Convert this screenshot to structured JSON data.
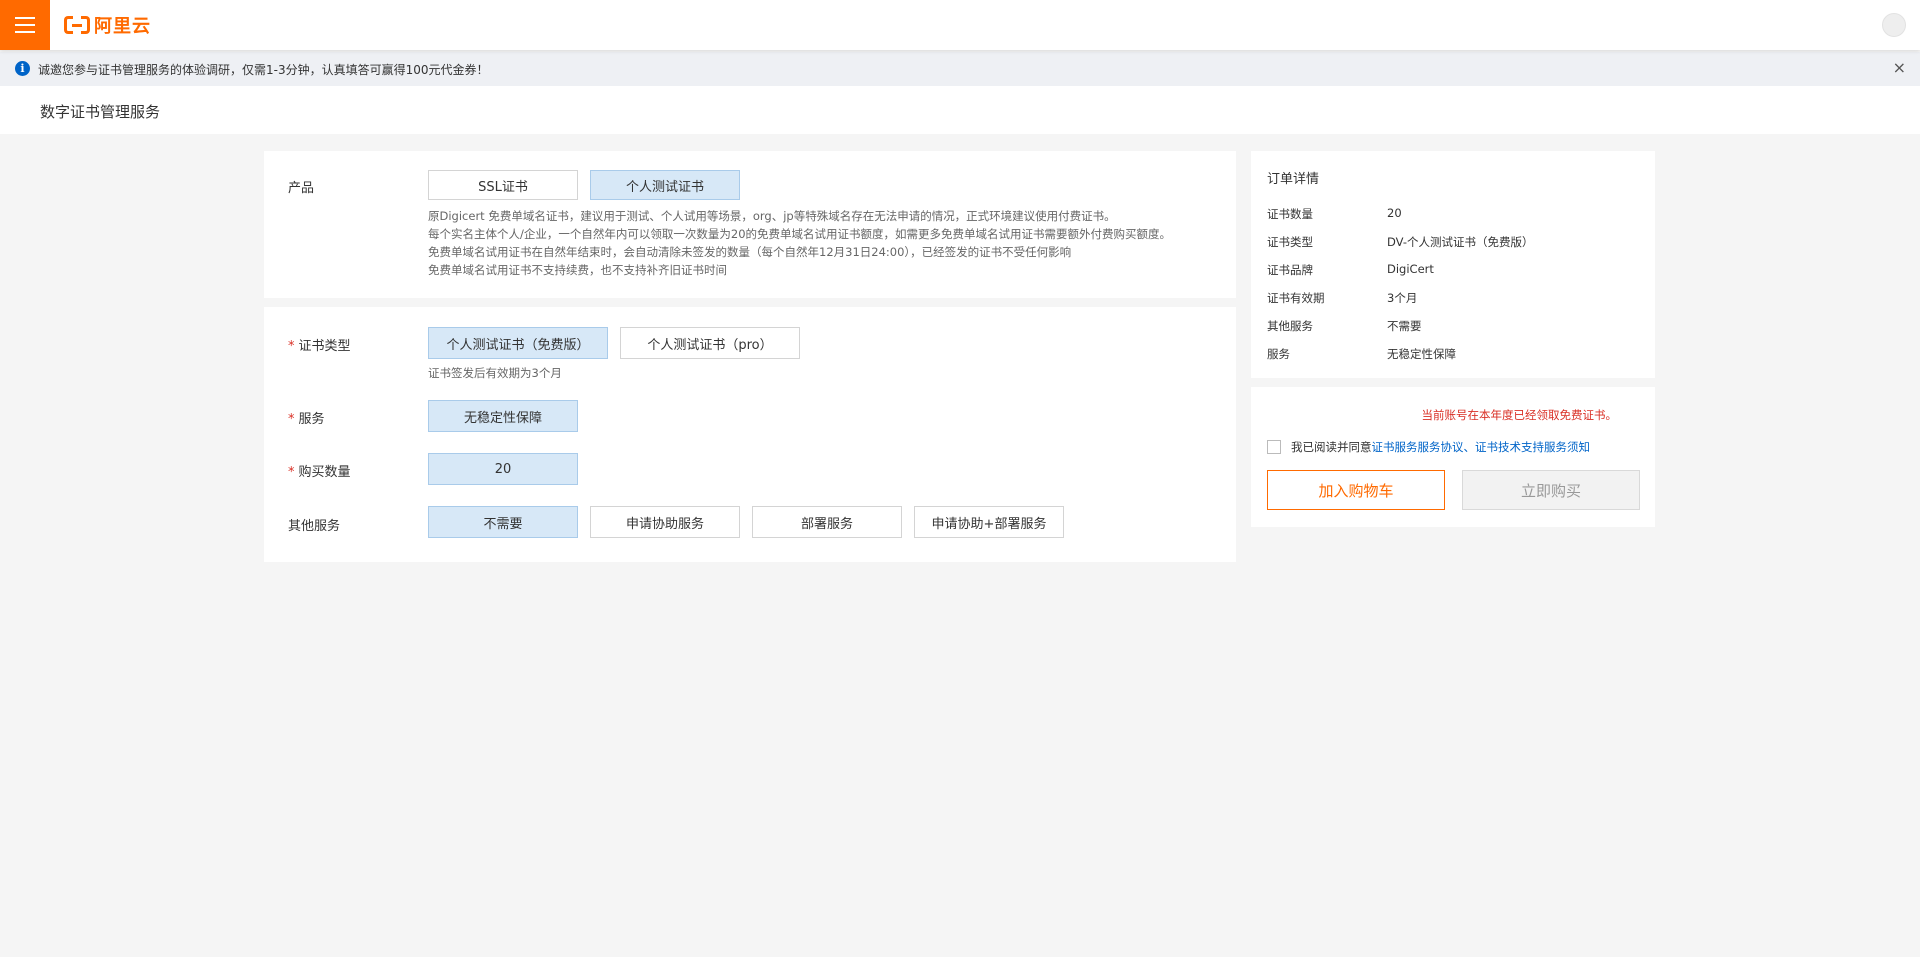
{
  "header": {
    "brand": "阿里云",
    "menu_icon": "hamburger-menu-icon",
    "avatar_icon": "user-avatar-icon"
  },
  "notice": {
    "text": "诚邀您参与证书管理服务的体验调研，仅需1-3分钟，认真填答可赢得100元代金券！",
    "info_icon": "i",
    "close": "×"
  },
  "page": {
    "title": "数字证书管理服务"
  },
  "product": {
    "label": "产品",
    "options": [
      "SSL证书",
      "个人测试证书"
    ],
    "selected": "个人测试证书",
    "description": [
      "原Digicert 免费单域名证书，建议用于测试、个人试用等场景，org、jp等特殊域名存在无法申请的情况，正式环境建议使用付费证书。",
      "每个实名主体个人/企业，一个自然年内可以领取一次数量为20的免费单域名试用证书额度，如需更多免费单域名试用证书需要额外付费购买额度。",
      "免费单域名试用证书在自然年结束时，会自动清除未签发的数量（每个自然年12月31日24:00），已经签发的证书不受任何影响",
      "免费单域名试用证书不支持续费，也不支持补齐旧证书时间"
    ]
  },
  "config": {
    "cert_type": {
      "label": "证书类型",
      "options": [
        "个人测试证书（免费版）",
        "个人测试证书（pro）"
      ],
      "hint": "证书签发后有效期为3个月"
    },
    "service": {
      "label": "服务",
      "value": "无稳定性保障"
    },
    "quantity": {
      "label": "购买数量",
      "value": "20"
    },
    "other_services": {
      "label": "其他服务",
      "options": [
        "不需要",
        "申请协助服务",
        "部署服务",
        "申请协助+部署服务"
      ]
    },
    "required_mark": "*"
  },
  "order": {
    "title": "订单详情",
    "rows": [
      {
        "key": "证书数量",
        "value": "20"
      },
      {
        "key": "证书类型",
        "value": "DV-个人测试证书（免费版）"
      },
      {
        "key": "证书品牌",
        "value": "DigiCert"
      },
      {
        "key": "证书有效期",
        "value": "3个月"
      },
      {
        "key": "其他服务",
        "value": "不需要"
      },
      {
        "key": "服务",
        "value": "无稳定性保障"
      }
    ]
  },
  "purchase": {
    "warning": "当前账号在本年度已经领取免费证书。",
    "agree_prefix": "我已阅读并同意",
    "agree_link1": "证书服务服务协议",
    "agree_sep": "、",
    "agree_link2": "证书技术支持服务须知",
    "add_to_cart": "加入购物车",
    "buy_now": "立即购买"
  },
  "colors": {
    "brand_orange": "#ff6a00",
    "selected_bg": "#d7e8f7",
    "link_blue": "#0064c8",
    "warning_red": "#d93026"
  }
}
